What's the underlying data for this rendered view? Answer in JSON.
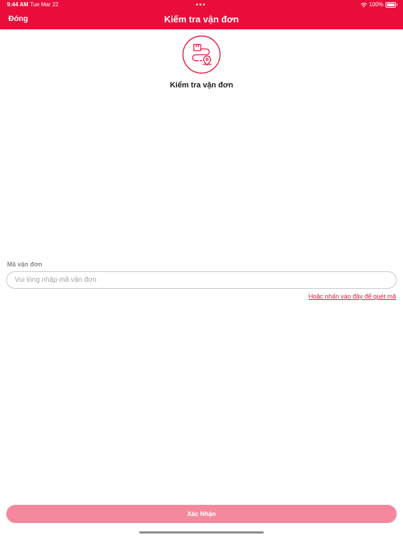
{
  "status_bar": {
    "time": "9:44 AM",
    "date": "Tue Mar 22",
    "battery": "100%",
    "battery_level": 1.0
  },
  "header": {
    "close_label": "Đóng",
    "title": "Kiểm tra vận đơn"
  },
  "hero": {
    "icon": "delivery-route-icon",
    "title": "Kiểm tra vận đơn"
  },
  "form": {
    "field_label": "Mã vận đơn",
    "field_value": "",
    "field_placeholder": "Vui lòng nhập mã vận đơn",
    "scan_link": "Hoặc nhấn vào đây để quét mã"
  },
  "footer": {
    "confirm_label": "Xác Nhận"
  },
  "colors": {
    "brand": "#ea0c3a",
    "confirm_disabled": "#f4889d",
    "link": "#e2173f"
  }
}
